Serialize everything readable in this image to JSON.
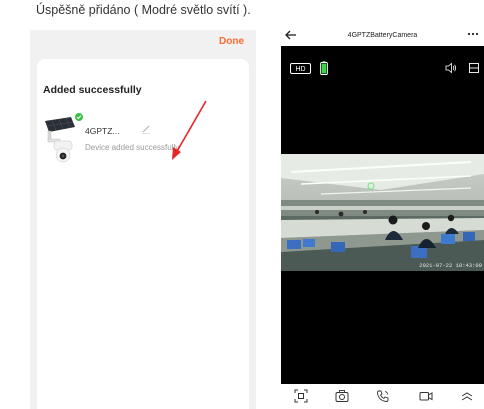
{
  "caption": "Úspěšně přidáno ( Modré světlo svítí ).",
  "pairing_screen": {
    "done_label": "Done",
    "title": "Added successfully",
    "device": {
      "name": "4GPTZ...",
      "status": "Device added successfully",
      "image_icon": "solar-ptz-camera",
      "status_icon": "green-check-badge"
    },
    "colors": {
      "accent": "#ff6a2c",
      "background": "#f1f1f1",
      "card": "#ffffff",
      "arrow": "#e8262a"
    }
  },
  "camera_screen": {
    "title": "4GPTZBatteryCamera",
    "quality_label": "HD",
    "timestamp": "2021-07-22 18:43:00",
    "icons": {
      "back": "arrow-left-icon",
      "more": "more-dots-icon",
      "battery": "battery-icon",
      "speaker": "speaker-icon",
      "fullscreen": "fullscreen-icon"
    },
    "toolbar": [
      "screenshot-icon",
      "camera-icon",
      "talk-icon",
      "record-icon",
      "expand-icon"
    ],
    "colors": {
      "battery": "#3bd34a",
      "background": "#000000"
    }
  }
}
